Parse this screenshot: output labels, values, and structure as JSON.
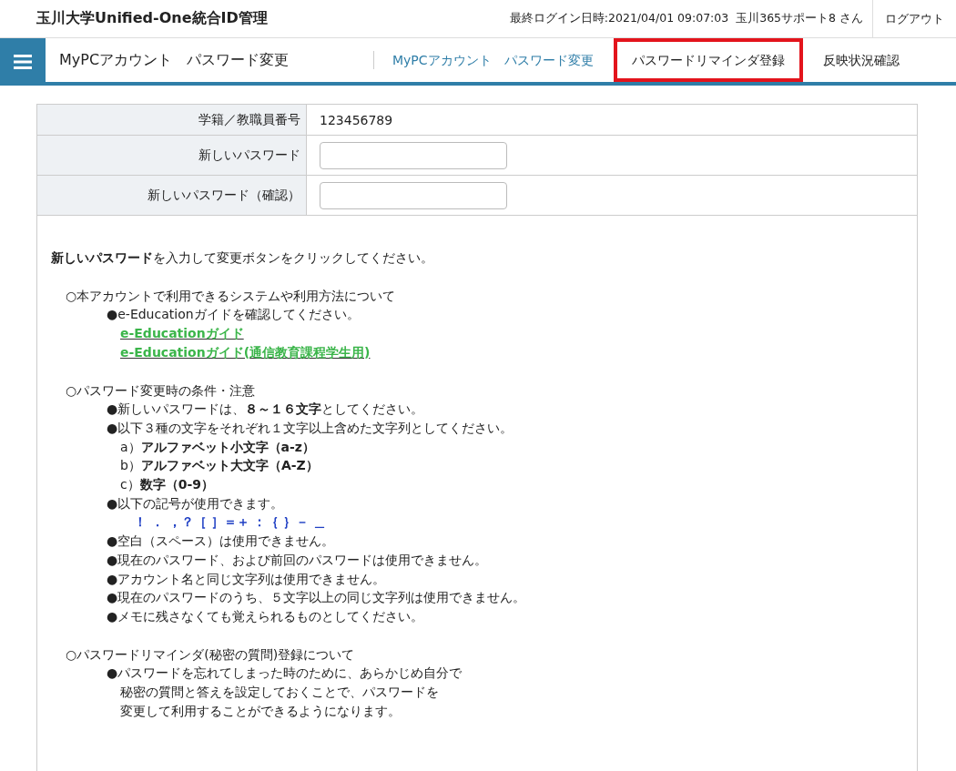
{
  "header": {
    "title": "玉川大学Unified-One統合ID管理",
    "last_login": "最終ログイン日時:2021/04/01 09:07:03",
    "user": "玉川365サポート8 さん",
    "logout": "ログアウト"
  },
  "nav": {
    "page_title": "MyPCアカウント　パスワード変更",
    "tabs": [
      {
        "label": "MyPCアカウント　パスワード変更",
        "selected": true,
        "highlighted": false
      },
      {
        "label": "パスワードリマインダ登録",
        "selected": false,
        "highlighted": true
      },
      {
        "label": "反映状況確認",
        "selected": false,
        "highlighted": false
      }
    ]
  },
  "form": [
    {
      "kind": "text",
      "label": "学籍／教職員番号",
      "value": "123456789"
    },
    {
      "kind": "input",
      "label": "新しいパスワード"
    },
    {
      "kind": "input",
      "label": "新しいパスワード（確認）"
    }
  ],
  "instructions": [
    {
      "kind": "intro",
      "text": "**新しいパスワード**を入力して変更ボタンをクリックしてください。"
    },
    {
      "kind": "heading",
      "text": "○本アカウントで利用できるシステムや利用方法について"
    },
    {
      "kind": "bullet",
      "text": "●e-Educationガイドを確認してください。"
    },
    {
      "kind": "link",
      "text": "e-Educationガイド"
    },
    {
      "kind": "link",
      "text": "e-Educationガイド(通信教育課程学生用)"
    },
    {
      "kind": "heading",
      "text": "○パスワード変更時の条件・注意"
    },
    {
      "kind": "bullet",
      "text": "●新しいパスワードは、**８～１６文字**としてください。"
    },
    {
      "kind": "bullet",
      "text": "●以下３種の文字をそれぞれ１文字以上含めた文字列としてください。"
    },
    {
      "kind": "sub",
      "text": "a）**アルファベット小文字（a-z）**"
    },
    {
      "kind": "sub",
      "text": "b）**アルファベット大文字（A-Z）**"
    },
    {
      "kind": "sub",
      "text": "c）**数字（0-9）**"
    },
    {
      "kind": "bullet",
      "text": "●以下の記号が使用できます。"
    },
    {
      "kind": "symbols",
      "text": "！ ． ，？［ ］＝＋ ：｛ ｝－ ＿"
    },
    {
      "kind": "bullet",
      "text": "●空白（スペース）は使用できません。"
    },
    {
      "kind": "bullet",
      "text": "●現在のパスワード、および前回のパスワードは使用できません。"
    },
    {
      "kind": "bullet",
      "text": "●アカウント名と同じ文字列は使用できません。"
    },
    {
      "kind": "bullet",
      "text": "●現在のパスワードのうち、５文字以上の同じ文字列は使用できません。"
    },
    {
      "kind": "bullet",
      "text": "●メモに残さなくても覚えられるものとしてください。"
    },
    {
      "kind": "heading",
      "text": "○パスワードリマインダ(秘密の質問)登録について"
    },
    {
      "kind": "bullet",
      "text": "●パスワードを忘れてしまった時のために、あらかじめ自分で"
    },
    {
      "kind": "cont",
      "text": "秘密の質問と答えを設定しておくことで、パスワードを"
    },
    {
      "kind": "cont",
      "text": "変更して利用することができるようになります。"
    }
  ]
}
